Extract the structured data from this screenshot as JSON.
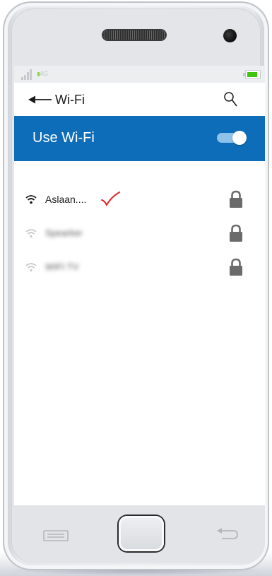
{
  "status_bar": {
    "network_type": "4G",
    "icons": [
      "signal-icon",
      "battery-icon"
    ],
    "colors": {
      "battery_fill": "#3ec40a",
      "network_dot": "#8cd64a"
    }
  },
  "header": {
    "title": "Wi-Fi",
    "back_icon": "arrow-left-icon",
    "search_icon": "search-icon"
  },
  "wifi_toggle": {
    "label": "Use Wi-Fi",
    "state": "on",
    "colors": {
      "bar_background": "#0d6db8",
      "track": "#8fc2ea",
      "knob": "#ffffff"
    }
  },
  "networks": [
    {
      "name": "Aslaan....",
      "signal": "strong",
      "secured": true,
      "selected": true,
      "check_icon": "red-checkmark-icon"
    },
    {
      "name": "Spearker",
      "signal": "weak",
      "secured": true,
      "selected": false,
      "obscured": true
    },
    {
      "name": "WIFI TV",
      "signal": "weak",
      "secured": true,
      "selected": false,
      "obscured": true
    }
  ],
  "nav_bar": {
    "icons": [
      "menu-key-icon",
      "home-key",
      "back-key-icon"
    ]
  }
}
